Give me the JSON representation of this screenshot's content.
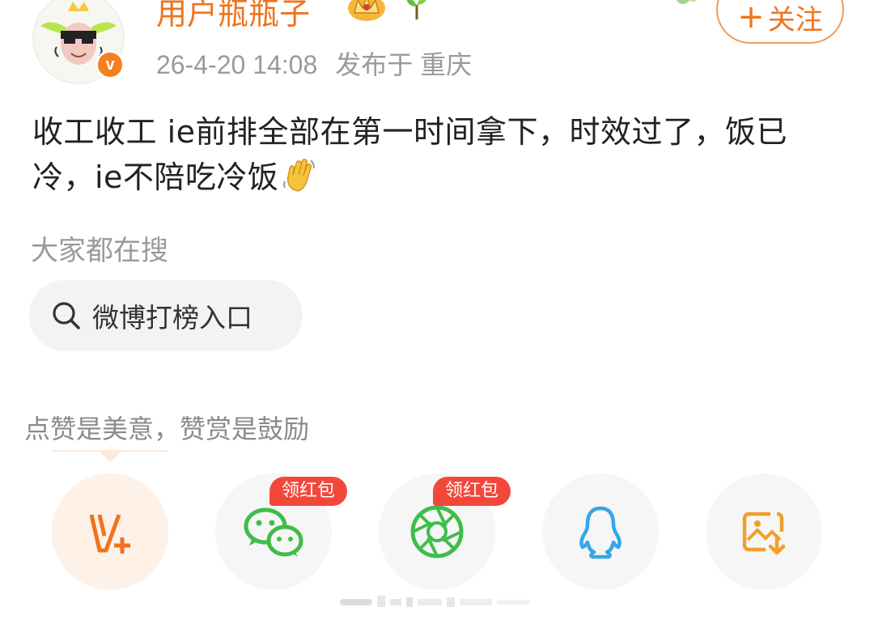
{
  "header": {
    "username": "用户瓶瓶子",
    "time": "26-4-20 14:08",
    "location": "发布于 重庆",
    "follow_label": "关注",
    "verify_mark": "v"
  },
  "post": {
    "text": "收工收工 ie前排全部在第一时间拿下，时效过了，饭已冷，ie不陪吃冷饭",
    "emoji": "waving-hand"
  },
  "hot_search": {
    "title": "大家都在搜",
    "chip_label": "微博打榜入口"
  },
  "praise": {
    "text": "点赞是美意，赞赏是鼓励"
  },
  "share": {
    "items": [
      {
        "name": "reward",
        "icon": "reward-v-plus-icon"
      },
      {
        "name": "wechat",
        "icon": "wechat-icon",
        "badge": "领红包"
      },
      {
        "name": "moments",
        "icon": "wechat-moments-icon",
        "badge": "领红包"
      },
      {
        "name": "qq",
        "icon": "qq-icon"
      },
      {
        "name": "save-image",
        "icon": "save-image-icon"
      }
    ]
  },
  "colors": {
    "accent": "#f0731f",
    "wechat_green": "#3fbd4b",
    "qq_blue": "#35a7e8",
    "red_badge": "#f2483b"
  }
}
